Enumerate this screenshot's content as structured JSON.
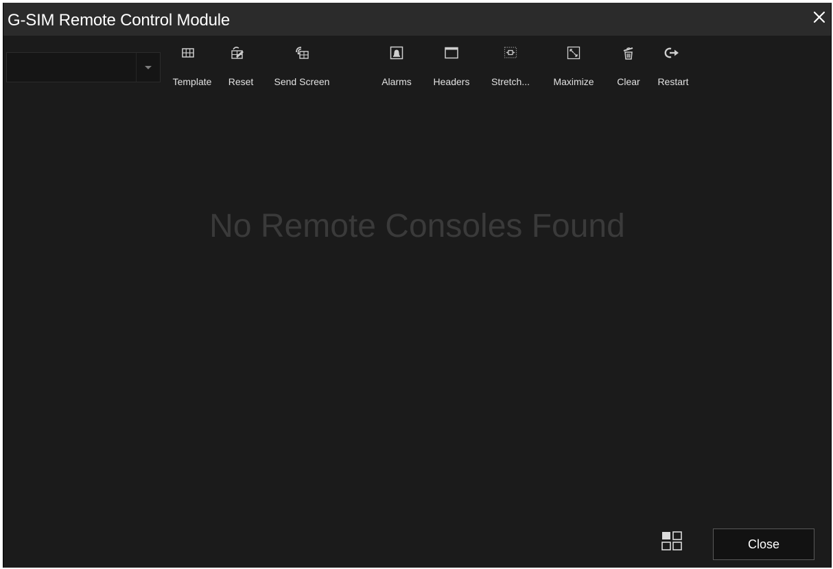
{
  "window": {
    "title": "G-SIM Remote Control Module",
    "close_icon": "close-icon"
  },
  "toolbar": {
    "console_select": {
      "value": "",
      "icon": "chevron-down-icon"
    },
    "buttons": [
      {
        "label": "Template",
        "icon": "grid-template-icon"
      },
      {
        "label": "Reset",
        "icon": "reset-layout-icon"
      },
      {
        "label": "Send Screen",
        "icon": "send-screen-icon"
      },
      {
        "label": "Alarms",
        "icon": "alarm-bell-icon"
      },
      {
        "label": "Headers",
        "icon": "window-header-icon"
      },
      {
        "label": "Stretch...",
        "icon": "stretch-icon"
      },
      {
        "label": "Maximize",
        "icon": "maximize-icon"
      },
      {
        "label": "Clear",
        "icon": "clear-trash-icon"
      },
      {
        "label": "Restart",
        "icon": "restart-arrow-icon"
      }
    ]
  },
  "main": {
    "empty_message": "No Remote Consoles Found"
  },
  "footer": {
    "layout_icon": "layout-tiles-icon",
    "close_label": "Close"
  },
  "colors": {
    "window_bg": "#1b1b1b",
    "titlebar_bg": "#2b2b2b",
    "text": "#e2e2e2",
    "muted_text": "#3a3a3a",
    "icon": "#cfcfcf"
  }
}
